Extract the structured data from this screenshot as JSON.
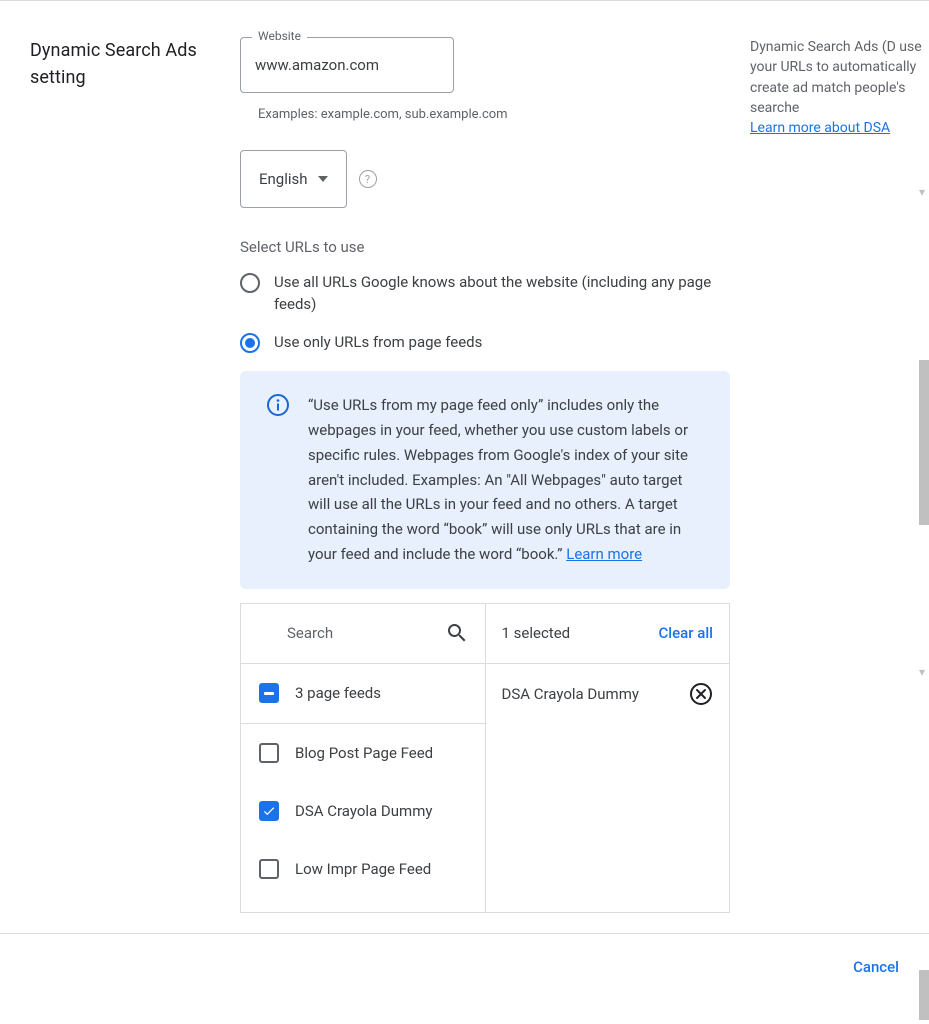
{
  "section_title": "Dynamic Search Ads setting",
  "website": {
    "label": "Website",
    "value": "www.amazon.com",
    "helper": "Examples: example.com, sub.example.com"
  },
  "language": {
    "selected": "English"
  },
  "urls_heading": "Select URLs to use",
  "radio_options": [
    {
      "label": "Use all URLs Google knows about the website (including any page feeds)",
      "selected": false
    },
    {
      "label": "Use only URLs from page feeds",
      "selected": true
    }
  ],
  "info_box": {
    "text": "“Use URLs from my page feed only” includes only the webpages in your feed, whether you use custom labels or specific rules. Webpages from Google's index of your site aren't included. Examples: An \"All Webpages\" auto target will use all the URLs in your feed and no others. A target containing the word “book” will use only URLs that are in your feed and include the word “book.” ",
    "link": "Learn more"
  },
  "feeds": {
    "search_placeholder": "Search",
    "summary": "3 page feeds",
    "items": [
      {
        "label": "Blog Post Page Feed",
        "checked": false
      },
      {
        "label": "DSA Crayola Dummy",
        "checked": true
      },
      {
        "label": "Low Impr Page Feed",
        "checked": false
      }
    ],
    "selected_count_label": "1 selected",
    "clear_all": "Clear all",
    "selected_items": [
      {
        "label": "DSA Crayola Dummy"
      }
    ]
  },
  "side_help": {
    "text": "Dynamic Search Ads (D use your URLs to automatically create ad match people's searche",
    "link": "Learn more about DSA"
  },
  "footer": {
    "cancel": "Cancel"
  }
}
